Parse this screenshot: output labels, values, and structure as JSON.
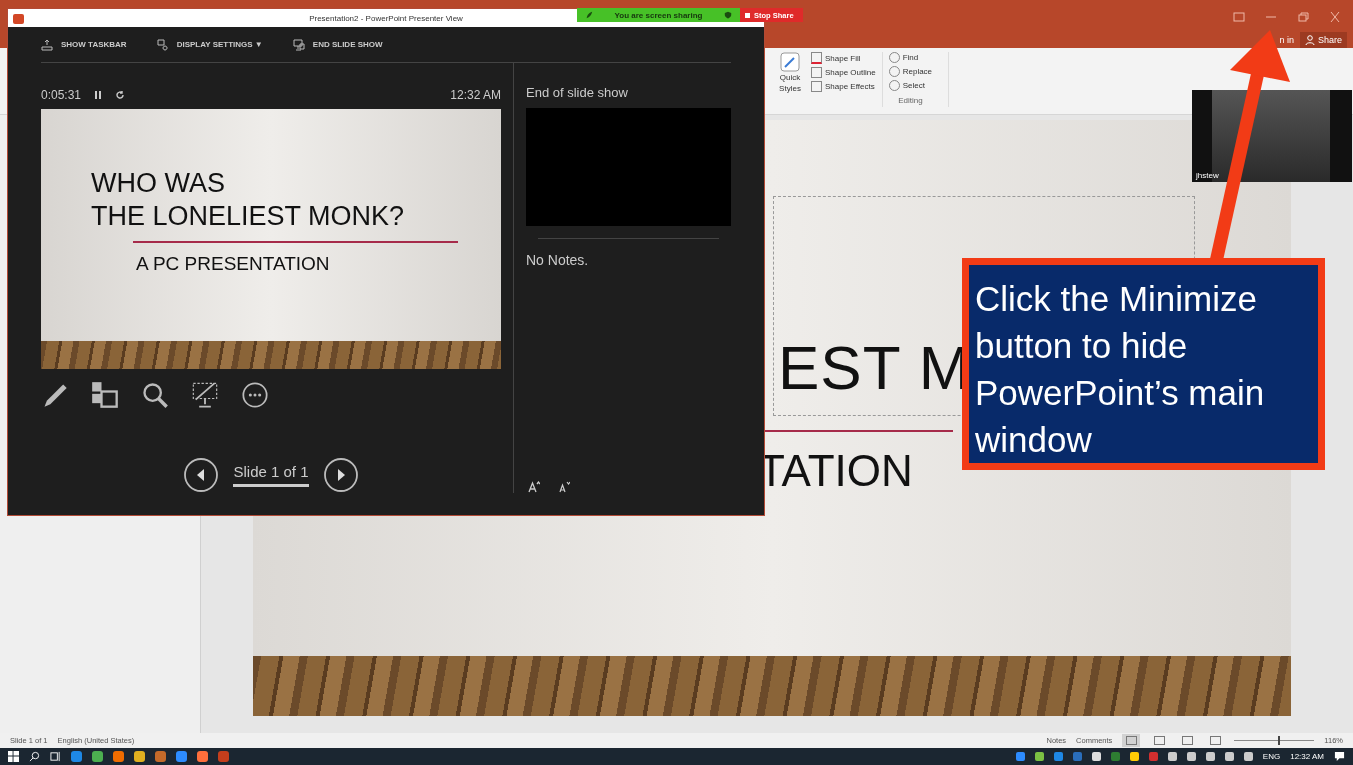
{
  "powerpoint": {
    "account": {
      "sign_in": "n in",
      "share": "Share"
    },
    "ribbon": {
      "quick_styles": [
        "Quick",
        "Styles"
      ],
      "shape": [
        "Shape Fill",
        "Shape Outline",
        "Shape Effects"
      ],
      "editing": [
        "Find",
        "Replace",
        "Select"
      ],
      "editing_label": "Editing"
    },
    "slide": {
      "title": "EST M",
      "subtitle": "TATION"
    },
    "status_bar": {
      "slide": "Slide 1 of 1",
      "language": "English (United States)",
      "notes": "Notes",
      "comments": "Comments",
      "views": [
        {
          "selected": true
        },
        {
          "selected": false
        },
        {
          "selected": false
        },
        {
          "selected": false
        }
      ],
      "zoom": {
        "level": 0.54
      },
      "zoom_reading": "116%"
    }
  },
  "presenter_window": {
    "title": "Presentation2 - PowerPoint Presenter View",
    "toolbar": [
      {
        "kind": "taskbar",
        "label": "SHOW TASKBAR"
      },
      {
        "kind": "display",
        "label": "DISPLAY SETTINGS ▼"
      },
      {
        "kind": "end",
        "label": "END SLIDE SHOW"
      }
    ],
    "timer": "0:05:31",
    "clock": "12:32 AM",
    "current_slide": {
      "lines": [
        "WHO WAS",
        "THE LONELIEST MONK?"
      ],
      "subtitle": "A PC PRESENTATION"
    },
    "next_label": "End of slide show",
    "notes": "No Notes.",
    "slide_counter": "Slide 1 of 1"
  },
  "screen_share": {
    "status": "You are screen sharing",
    "stop": "Stop Share"
  },
  "video": {
    "name": "jhstew"
  },
  "callout": "Click the Minimize button to hide PowerPoint’s main window",
  "taskbar": {
    "language": "ENG",
    "time": "12:32 AM"
  }
}
